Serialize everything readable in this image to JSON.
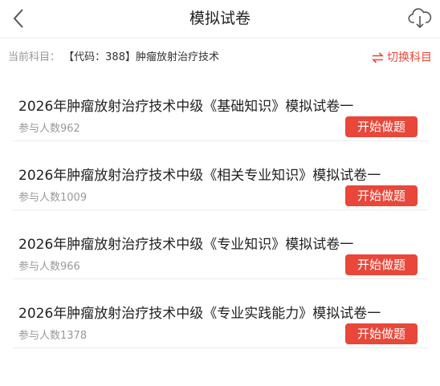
{
  "header": {
    "title": "模拟试卷",
    "back_icon": "chevron-left-icon",
    "download_icon": "cloud-download-icon"
  },
  "subject": {
    "prefix": "当前科目：",
    "name": "【代码：388】肿瘤放射治疗技术",
    "switch_label": "切换科目",
    "switch_icon": "swap-arrows-icon"
  },
  "papers": [
    {
      "title": "2026年肿瘤放射治疗技术中级《基础知识》模拟试卷一",
      "count": "参与人数962",
      "button": "开始做题"
    },
    {
      "title": "2026年肿瘤放射治疗技术中级《相关专业知识》模拟试卷一",
      "count": "参与人数1009",
      "button": "开始做题"
    },
    {
      "title": "2026年肿瘤放射治疗技术中级《专业知识》模拟试卷一",
      "count": "参与人数966",
      "button": "开始做题"
    },
    {
      "title": "2026年肿瘤放射治疗技术中级《专业实践能力》模拟试卷一",
      "count": "参与人数1378",
      "button": "开始做题"
    }
  ],
  "colors": {
    "accent": "#e8473a",
    "muted_text": "#999999",
    "divider": "#ececec"
  }
}
